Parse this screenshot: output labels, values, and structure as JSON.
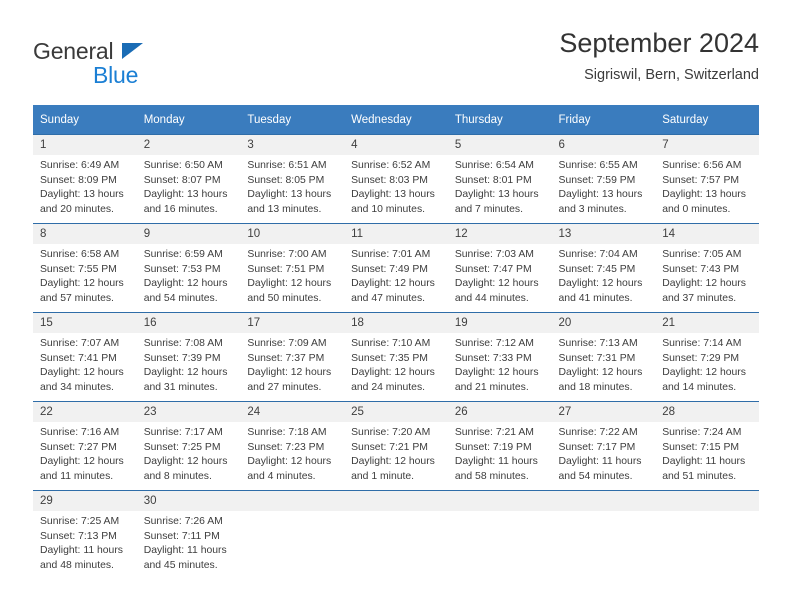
{
  "logo": {
    "primary_text": "General",
    "secondary_text": "Blue",
    "primary_color": "#3a3a3a",
    "secondary_color": "#1b7fd4",
    "triangle_color": "#1a6cb5"
  },
  "header": {
    "title": "September 2024",
    "subtitle": "Sigriswil, Bern, Switzerland"
  },
  "theme": {
    "header_bar_color": "#3a7cbe",
    "grid_line_color": "#2f6da8",
    "daynum_band_color": "#f1f1f1",
    "text_color": "#3d3d3d"
  },
  "calendar": {
    "weekday_headers": [
      "Sunday",
      "Monday",
      "Tuesday",
      "Wednesday",
      "Thursday",
      "Friday",
      "Saturday"
    ],
    "weeks": [
      [
        {
          "day": "1",
          "sunrise": "Sunrise: 6:49 AM",
          "sunset": "Sunset: 8:09 PM",
          "daylight": "Daylight: 13 hours and 20 minutes."
        },
        {
          "day": "2",
          "sunrise": "Sunrise: 6:50 AM",
          "sunset": "Sunset: 8:07 PM",
          "daylight": "Daylight: 13 hours and 16 minutes."
        },
        {
          "day": "3",
          "sunrise": "Sunrise: 6:51 AM",
          "sunset": "Sunset: 8:05 PM",
          "daylight": "Daylight: 13 hours and 13 minutes."
        },
        {
          "day": "4",
          "sunrise": "Sunrise: 6:52 AM",
          "sunset": "Sunset: 8:03 PM",
          "daylight": "Daylight: 13 hours and 10 minutes."
        },
        {
          "day": "5",
          "sunrise": "Sunrise: 6:54 AM",
          "sunset": "Sunset: 8:01 PM",
          "daylight": "Daylight: 13 hours and 7 minutes."
        },
        {
          "day": "6",
          "sunrise": "Sunrise: 6:55 AM",
          "sunset": "Sunset: 7:59 PM",
          "daylight": "Daylight: 13 hours and 3 minutes."
        },
        {
          "day": "7",
          "sunrise": "Sunrise: 6:56 AM",
          "sunset": "Sunset: 7:57 PM",
          "daylight": "Daylight: 13 hours and 0 minutes."
        }
      ],
      [
        {
          "day": "8",
          "sunrise": "Sunrise: 6:58 AM",
          "sunset": "Sunset: 7:55 PM",
          "daylight": "Daylight: 12 hours and 57 minutes."
        },
        {
          "day": "9",
          "sunrise": "Sunrise: 6:59 AM",
          "sunset": "Sunset: 7:53 PM",
          "daylight": "Daylight: 12 hours and 54 minutes."
        },
        {
          "day": "10",
          "sunrise": "Sunrise: 7:00 AM",
          "sunset": "Sunset: 7:51 PM",
          "daylight": "Daylight: 12 hours and 50 minutes."
        },
        {
          "day": "11",
          "sunrise": "Sunrise: 7:01 AM",
          "sunset": "Sunset: 7:49 PM",
          "daylight": "Daylight: 12 hours and 47 minutes."
        },
        {
          "day": "12",
          "sunrise": "Sunrise: 7:03 AM",
          "sunset": "Sunset: 7:47 PM",
          "daylight": "Daylight: 12 hours and 44 minutes."
        },
        {
          "day": "13",
          "sunrise": "Sunrise: 7:04 AM",
          "sunset": "Sunset: 7:45 PM",
          "daylight": "Daylight: 12 hours and 41 minutes."
        },
        {
          "day": "14",
          "sunrise": "Sunrise: 7:05 AM",
          "sunset": "Sunset: 7:43 PM",
          "daylight": "Daylight: 12 hours and 37 minutes."
        }
      ],
      [
        {
          "day": "15",
          "sunrise": "Sunrise: 7:07 AM",
          "sunset": "Sunset: 7:41 PM",
          "daylight": "Daylight: 12 hours and 34 minutes."
        },
        {
          "day": "16",
          "sunrise": "Sunrise: 7:08 AM",
          "sunset": "Sunset: 7:39 PM",
          "daylight": "Daylight: 12 hours and 31 minutes."
        },
        {
          "day": "17",
          "sunrise": "Sunrise: 7:09 AM",
          "sunset": "Sunset: 7:37 PM",
          "daylight": "Daylight: 12 hours and 27 minutes."
        },
        {
          "day": "18",
          "sunrise": "Sunrise: 7:10 AM",
          "sunset": "Sunset: 7:35 PM",
          "daylight": "Daylight: 12 hours and 24 minutes."
        },
        {
          "day": "19",
          "sunrise": "Sunrise: 7:12 AM",
          "sunset": "Sunset: 7:33 PM",
          "daylight": "Daylight: 12 hours and 21 minutes."
        },
        {
          "day": "20",
          "sunrise": "Sunrise: 7:13 AM",
          "sunset": "Sunset: 7:31 PM",
          "daylight": "Daylight: 12 hours and 18 minutes."
        },
        {
          "day": "21",
          "sunrise": "Sunrise: 7:14 AM",
          "sunset": "Sunset: 7:29 PM",
          "daylight": "Daylight: 12 hours and 14 minutes."
        }
      ],
      [
        {
          "day": "22",
          "sunrise": "Sunrise: 7:16 AM",
          "sunset": "Sunset: 7:27 PM",
          "daylight": "Daylight: 12 hours and 11 minutes."
        },
        {
          "day": "23",
          "sunrise": "Sunrise: 7:17 AM",
          "sunset": "Sunset: 7:25 PM",
          "daylight": "Daylight: 12 hours and 8 minutes."
        },
        {
          "day": "24",
          "sunrise": "Sunrise: 7:18 AM",
          "sunset": "Sunset: 7:23 PM",
          "daylight": "Daylight: 12 hours and 4 minutes."
        },
        {
          "day": "25",
          "sunrise": "Sunrise: 7:20 AM",
          "sunset": "Sunset: 7:21 PM",
          "daylight": "Daylight: 12 hours and 1 minute."
        },
        {
          "day": "26",
          "sunrise": "Sunrise: 7:21 AM",
          "sunset": "Sunset: 7:19 PM",
          "daylight": "Daylight: 11 hours and 58 minutes."
        },
        {
          "day": "27",
          "sunrise": "Sunrise: 7:22 AM",
          "sunset": "Sunset: 7:17 PM",
          "daylight": "Daylight: 11 hours and 54 minutes."
        },
        {
          "day": "28",
          "sunrise": "Sunrise: 7:24 AM",
          "sunset": "Sunset: 7:15 PM",
          "daylight": "Daylight: 11 hours and 51 minutes."
        }
      ],
      [
        {
          "day": "29",
          "sunrise": "Sunrise: 7:25 AM",
          "sunset": "Sunset: 7:13 PM",
          "daylight": "Daylight: 11 hours and 48 minutes."
        },
        {
          "day": "30",
          "sunrise": "Sunrise: 7:26 AM",
          "sunset": "Sunset: 7:11 PM",
          "daylight": "Daylight: 11 hours and 45 minutes."
        },
        {
          "day": "",
          "sunrise": "",
          "sunset": "",
          "daylight": ""
        },
        {
          "day": "",
          "sunrise": "",
          "sunset": "",
          "daylight": ""
        },
        {
          "day": "",
          "sunrise": "",
          "sunset": "",
          "daylight": ""
        },
        {
          "day": "",
          "sunrise": "",
          "sunset": "",
          "daylight": ""
        },
        {
          "day": "",
          "sunrise": "",
          "sunset": "",
          "daylight": ""
        }
      ]
    ]
  }
}
